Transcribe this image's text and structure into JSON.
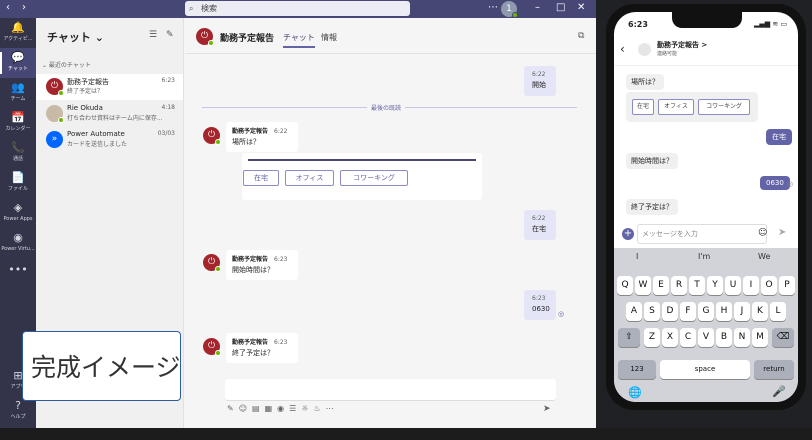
{
  "teams": {
    "search_placeholder": "検索",
    "avatar_initial": "1",
    "rail": [
      {
        "icon": "bell-icon",
        "glyph": "🔔",
        "label": "アクティビ..."
      },
      {
        "icon": "chat-icon",
        "glyph": "💬",
        "label": "チャット"
      },
      {
        "icon": "teams-icon",
        "glyph": "👥",
        "label": "チーム"
      },
      {
        "icon": "calendar-icon",
        "glyph": "📅",
        "label": "カレンダー"
      },
      {
        "icon": "call-icon",
        "glyph": "📞",
        "label": "通話"
      },
      {
        "icon": "files-icon",
        "glyph": "📄",
        "label": "ファイル"
      },
      {
        "icon": "power-apps-icon",
        "glyph": "◈",
        "label": "Power Apps"
      },
      {
        "icon": "power-virtual-agents-icon",
        "glyph": "◉",
        "label": "Power Virtu..."
      },
      {
        "icon": "more-icon",
        "glyph": "•••",
        "label": ""
      }
    ],
    "rail_bottom": [
      {
        "icon": "apps-icon",
        "glyph": "⊞",
        "label": "アプリ"
      },
      {
        "icon": "help-icon",
        "glyph": "?",
        "label": "ヘルプ"
      }
    ],
    "chatlist": {
      "title": "チャット ⌄",
      "recent_label": "⌄ 最近のチャット",
      "items": [
        {
          "name": "勤務予定報告",
          "preview": "終了予定は？",
          "time": "6:23"
        },
        {
          "name": "Rie Okuda",
          "preview": "打ち合わせ資料はチーム内に保存...",
          "time": "4:18"
        },
        {
          "name": "Power Automate",
          "preview": "カードを送信しました",
          "time": "03/03"
        }
      ]
    },
    "header": {
      "name": "勤務予定報告",
      "tab_chat": "チャット",
      "tab_info": "情報"
    },
    "divider": "最後の既読",
    "messages": {
      "out1": {
        "time": "6:22",
        "text": "開始"
      },
      "in1": {
        "sender": "勤務予定報告",
        "time": "6:22",
        "text": "場所は？"
      },
      "card_buttons": [
        "在宅",
        "オフィス",
        "コワーキング"
      ],
      "out2": {
        "time": "6:22",
        "text": "在宅"
      },
      "in2": {
        "sender": "勤務予定報告",
        "time": "6:23",
        "text": "開始時間は？"
      },
      "out3": {
        "time": "6:23",
        "text": "0630"
      },
      "in3": {
        "sender": "勤務予定報告",
        "time": "6:23",
        "text": "終了予定は？"
      }
    },
    "toolbar_icons": "✎☺▤▦◉☰☼♨⋯",
    "send_icon": "➤",
    "overlay_text": "完成イメージ"
  },
  "phone": {
    "time": "6:23",
    "status": "▂▄▆ ≋ ▭",
    "title": "勤務予定報告 >",
    "subtitle": "連絡可能",
    "messages": {
      "in_place": "場所は？",
      "buttons": [
        "在宅",
        "オフィス",
        "コワーキング"
      ],
      "out_place": "在宅",
      "in_start": "開始時間は？",
      "out_start": "0630",
      "in_end": "終了予定は？"
    },
    "input_placeholder": "メッセージを入力",
    "suggestions": [
      "I",
      "I'm",
      "We"
    ],
    "keys_row1": [
      "Q",
      "W",
      "E",
      "R",
      "T",
      "Y",
      "U",
      "I",
      "O",
      "P"
    ],
    "keys_row2": [
      "A",
      "S",
      "D",
      "F",
      "G",
      "H",
      "J",
      "K",
      "L"
    ],
    "keys_row3": [
      "Z",
      "X",
      "C",
      "V",
      "B",
      "N",
      "M"
    ],
    "key_123": "123",
    "key_space": "space",
    "key_return": "return"
  }
}
